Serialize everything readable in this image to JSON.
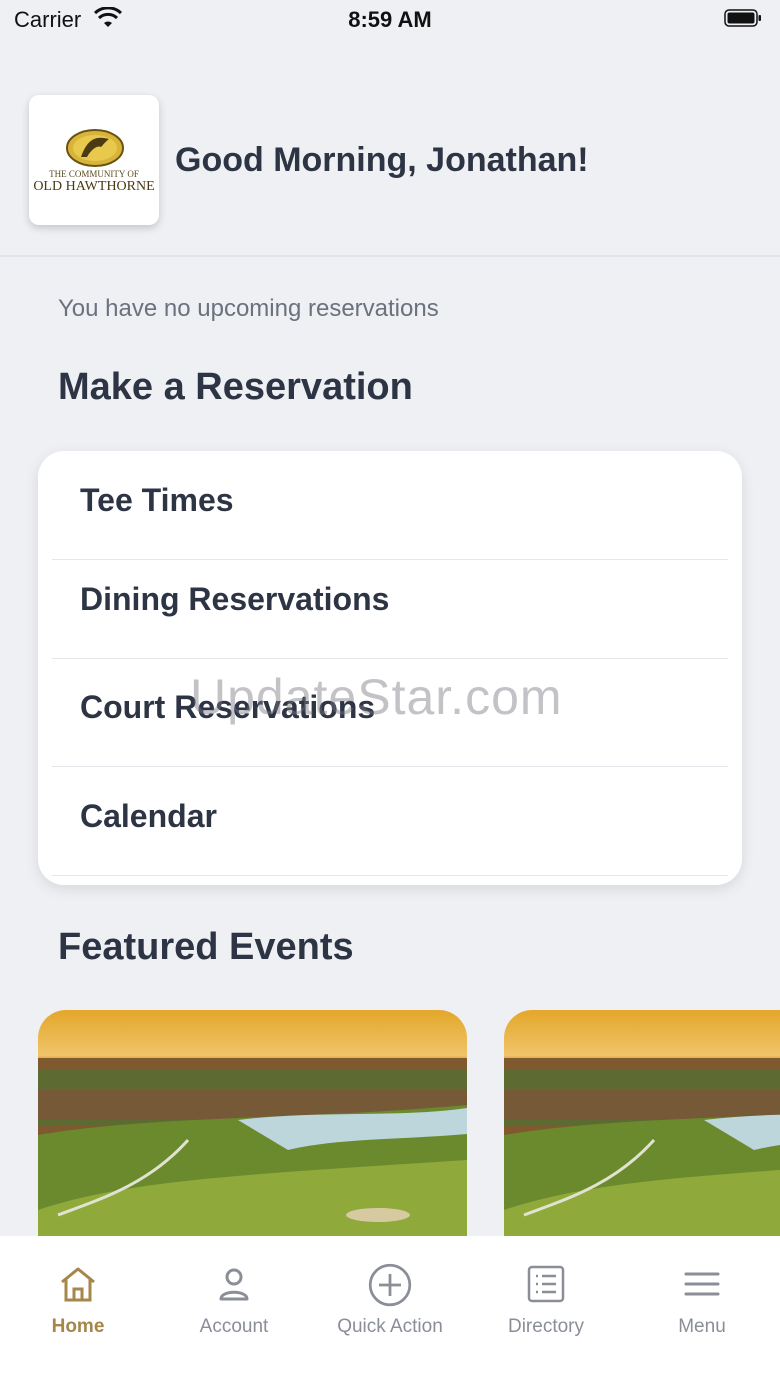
{
  "status_bar": {
    "carrier": "Carrier",
    "time": "8:59 AM"
  },
  "header": {
    "logo_text_top": "THE COMMUNITY OF",
    "logo_text_main": "OLD HAWTHORNE",
    "greeting": "Good Morning, Jonathan!"
  },
  "reservations": {
    "empty_message": "You have no upcoming reservations",
    "section_title": "Make a Reservation",
    "items": [
      {
        "label": "Tee Times"
      },
      {
        "label": "Dining Reservations"
      },
      {
        "label": "Court Reservations"
      },
      {
        "label": "Calendar"
      }
    ]
  },
  "events": {
    "section_title": "Featured Events"
  },
  "watermark": "UpdateStar.com",
  "tab_bar": {
    "active": "Home",
    "accent_color": "#a5874a",
    "items": [
      {
        "label": "Home",
        "icon": "home-icon"
      },
      {
        "label": "Account",
        "icon": "user-icon"
      },
      {
        "label": "Quick Action",
        "icon": "plus-circle-icon"
      },
      {
        "label": "Directory",
        "icon": "list-document-icon"
      },
      {
        "label": "Menu",
        "icon": "hamburger-icon"
      }
    ]
  }
}
